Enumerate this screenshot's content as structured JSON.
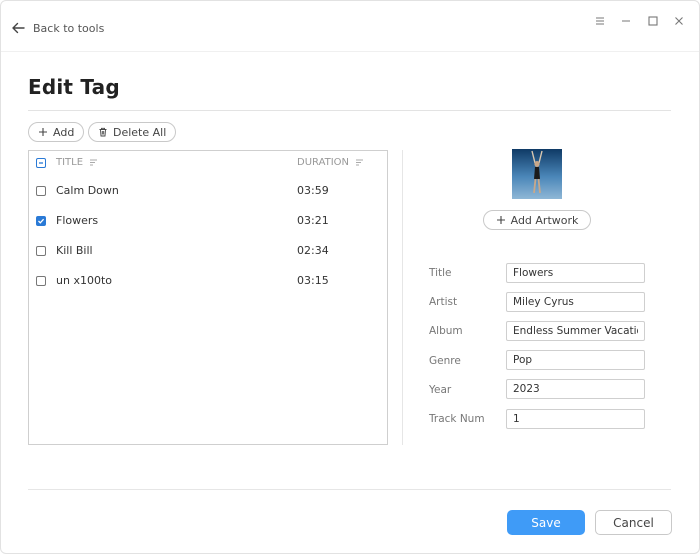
{
  "header": {
    "back_label": "Back to tools",
    "page_title": "Edit Tag"
  },
  "toolbar": {
    "add_label": "Add",
    "delete_all_label": "Delete All"
  },
  "table": {
    "columns": {
      "title": "TITLE",
      "duration": "DURATION"
    },
    "rows": [
      {
        "title": "Calm Down",
        "duration": "03:59",
        "checked": false
      },
      {
        "title": "Flowers",
        "duration": "03:21",
        "checked": true
      },
      {
        "title": "Kill Bill",
        "duration": "02:34",
        "checked": false
      },
      {
        "title": "un x100to",
        "duration": "03:15",
        "checked": false
      }
    ]
  },
  "artwork": {
    "add_label": "Add Artwork"
  },
  "form": {
    "title_label": "Title",
    "title_value": "Flowers",
    "artist_label": "Artist",
    "artist_value": "Miley Cyrus",
    "album_label": "Album",
    "album_value": "Endless Summer Vacation",
    "genre_label": "Genre",
    "genre_value": "Pop",
    "year_label": "Year",
    "year_value": "2023",
    "track_label": "Track Num",
    "track_value": "1"
  },
  "footer": {
    "save_label": "Save",
    "cancel_label": "Cancel"
  },
  "colors": {
    "accent": "#3f9bf7",
    "checkbox_accent": "#2a7ad6"
  }
}
